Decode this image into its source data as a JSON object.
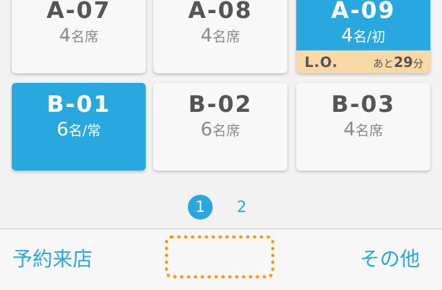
{
  "tables": [
    {
      "code": "A-07",
      "seat_count": "4",
      "seat_suffix": "名席",
      "active": false
    },
    {
      "code": "A-08",
      "seat_count": "4",
      "seat_suffix": "名席",
      "active": false
    },
    {
      "code": "A-09",
      "seat_count": "4",
      "seat_suffix": "名/初",
      "active": true,
      "last_order": {
        "label": "L.O.",
        "prefix": "あと",
        "minutes": "29",
        "unit": "分"
      }
    },
    {
      "code": "B-01",
      "seat_count": "6",
      "seat_suffix": "名/常",
      "active": true
    },
    {
      "code": "B-02",
      "seat_count": "6",
      "seat_suffix": "名席",
      "active": false
    },
    {
      "code": "B-03",
      "seat_count": "4",
      "seat_suffix": "名席",
      "active": false
    }
  ],
  "pagination": {
    "pages": [
      "1",
      "2"
    ],
    "current": "1"
  },
  "bottom_bar": {
    "left_label": "予約来店",
    "right_label": "その他"
  },
  "colors": {
    "accent": "#29a8e0",
    "card_bg": "#f8f8f8",
    "last_order_bg": "#f8d8a4",
    "highlight_dotted": "#f59a12"
  }
}
